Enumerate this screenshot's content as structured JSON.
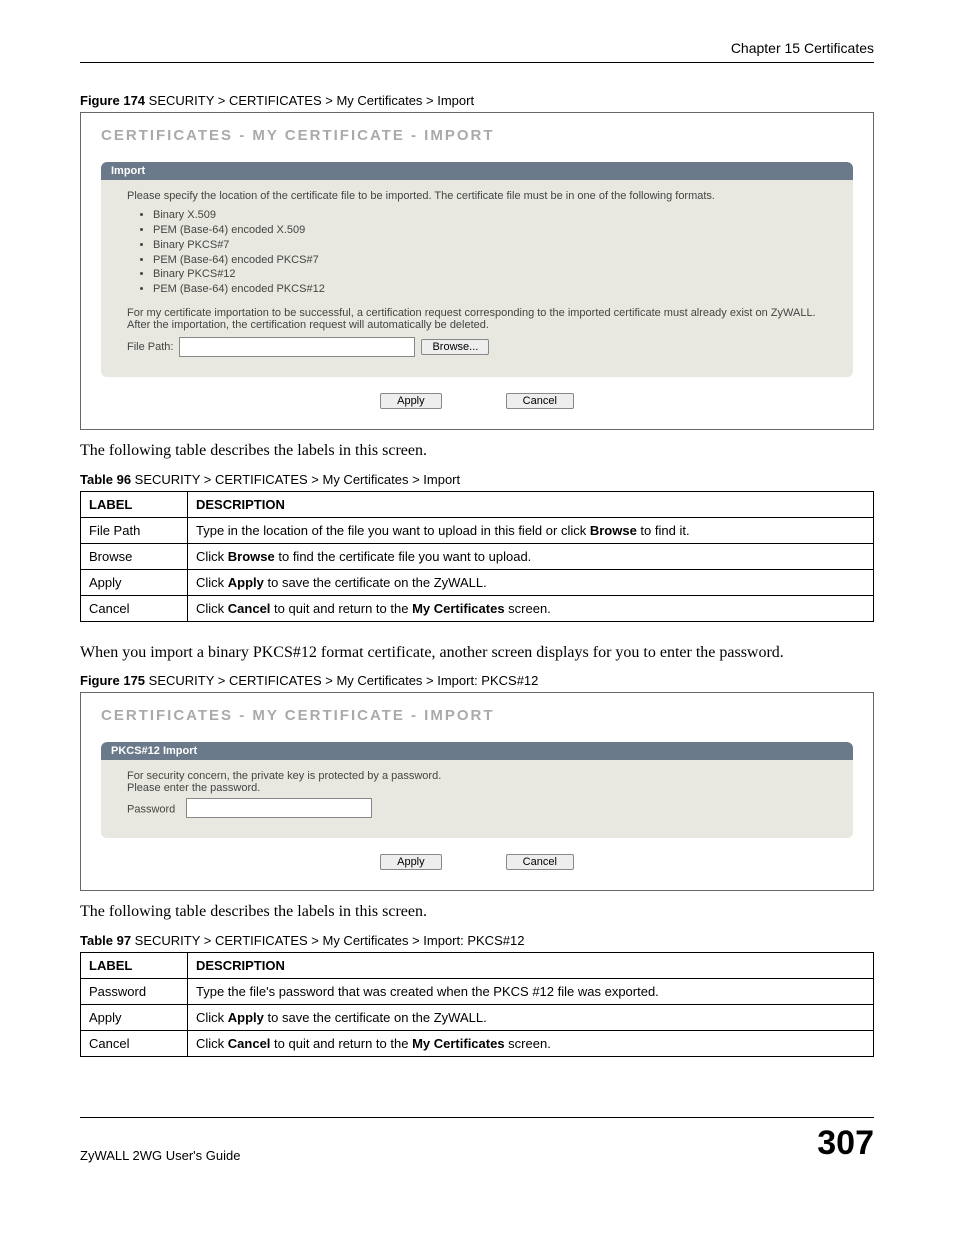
{
  "chapter_header": "Chapter 15 Certificates",
  "figure174": {
    "caption_bold": "Figure 174",
    "caption_rest": "   SECURITY > CERTIFICATES > My Certificates > Import",
    "title": "CERTIFICATES - MY CERTIFICATE - IMPORT",
    "panel_header": "Import",
    "intro": "Please specify the location of the certificate file to be imported. The certificate file must be in one of the following formats.",
    "formats": [
      "Binary X.509",
      "PEM (Base-64) encoded X.509",
      "Binary PKCS#7",
      "PEM (Base-64) encoded PKCS#7",
      "Binary PKCS#12",
      "PEM (Base-64) encoded PKCS#12"
    ],
    "note": "For my certificate importation to be successful, a certification request corresponding to the imported certificate must already exist on ZyWALL. After the importation, the certification request will automatically be deleted.",
    "file_label": "File Path:",
    "browse": "Browse...",
    "apply": "Apply",
    "cancel": "Cancel"
  },
  "para1": "The following table describes the labels in this screen.",
  "table96": {
    "caption_bold": "Table 96",
    "caption_rest": "   SECURITY > CERTIFICATES > My Certificates > Import",
    "headers": {
      "label": "LABEL",
      "desc": "DESCRIPTION"
    },
    "rows": [
      {
        "label": "File Path",
        "desc_pre": "Type in the location of the file you want to upload in this field or click ",
        "desc_bold": "Browse",
        "desc_post": " to find it."
      },
      {
        "label": "Browse",
        "desc_pre": "Click ",
        "desc_bold": "Browse",
        "desc_post": " to find the certificate file you want to upload."
      },
      {
        "label": "Apply",
        "desc_pre": "Click ",
        "desc_bold": "Apply",
        "desc_post": " to save the certificate on the ZyWALL."
      },
      {
        "label": "Cancel",
        "desc_pre": "Click ",
        "desc_bold": "Cancel",
        "desc_post_pre": " to quit and return to the ",
        "desc_bold2": "My Certificates",
        "desc_post": " screen."
      }
    ]
  },
  "para2": "When you import a binary PKCS#12 format certificate, another screen displays for you to enter the password.",
  "figure175": {
    "caption_bold": "Figure 175",
    "caption_rest": "   SECURITY > CERTIFICATES > My Certificates > Import: PKCS#12",
    "title": "CERTIFICATES - MY CERTIFICATE - IMPORT",
    "panel_header": "PKCS#12 Import",
    "line1": "For security concern, the private key is protected by a password.",
    "line2": "Please enter the password.",
    "pwd_label": "Password",
    "apply": "Apply",
    "cancel": "Cancel"
  },
  "para3": "The following table describes the labels in this screen.",
  "table97": {
    "caption_bold": "Table 97",
    "caption_rest": "   SECURITY > CERTIFICATES > My Certificates > Import: PKCS#12",
    "headers": {
      "label": "LABEL",
      "desc": "DESCRIPTION"
    },
    "rows": [
      {
        "label": "Password",
        "desc": "Type the file's password that was created when the PKCS #12 file was exported."
      },
      {
        "label": "Apply",
        "desc_pre": "Click ",
        "desc_bold": "Apply",
        "desc_post": " to save the certificate on the ZyWALL."
      },
      {
        "label": "Cancel",
        "desc_pre": "Click ",
        "desc_bold": "Cancel",
        "desc_post_pre": " to quit and return to the ",
        "desc_bold2": "My Certificates",
        "desc_post": " screen."
      }
    ]
  },
  "footer": {
    "left": "ZyWALL 2WG User's Guide",
    "right": "307"
  }
}
